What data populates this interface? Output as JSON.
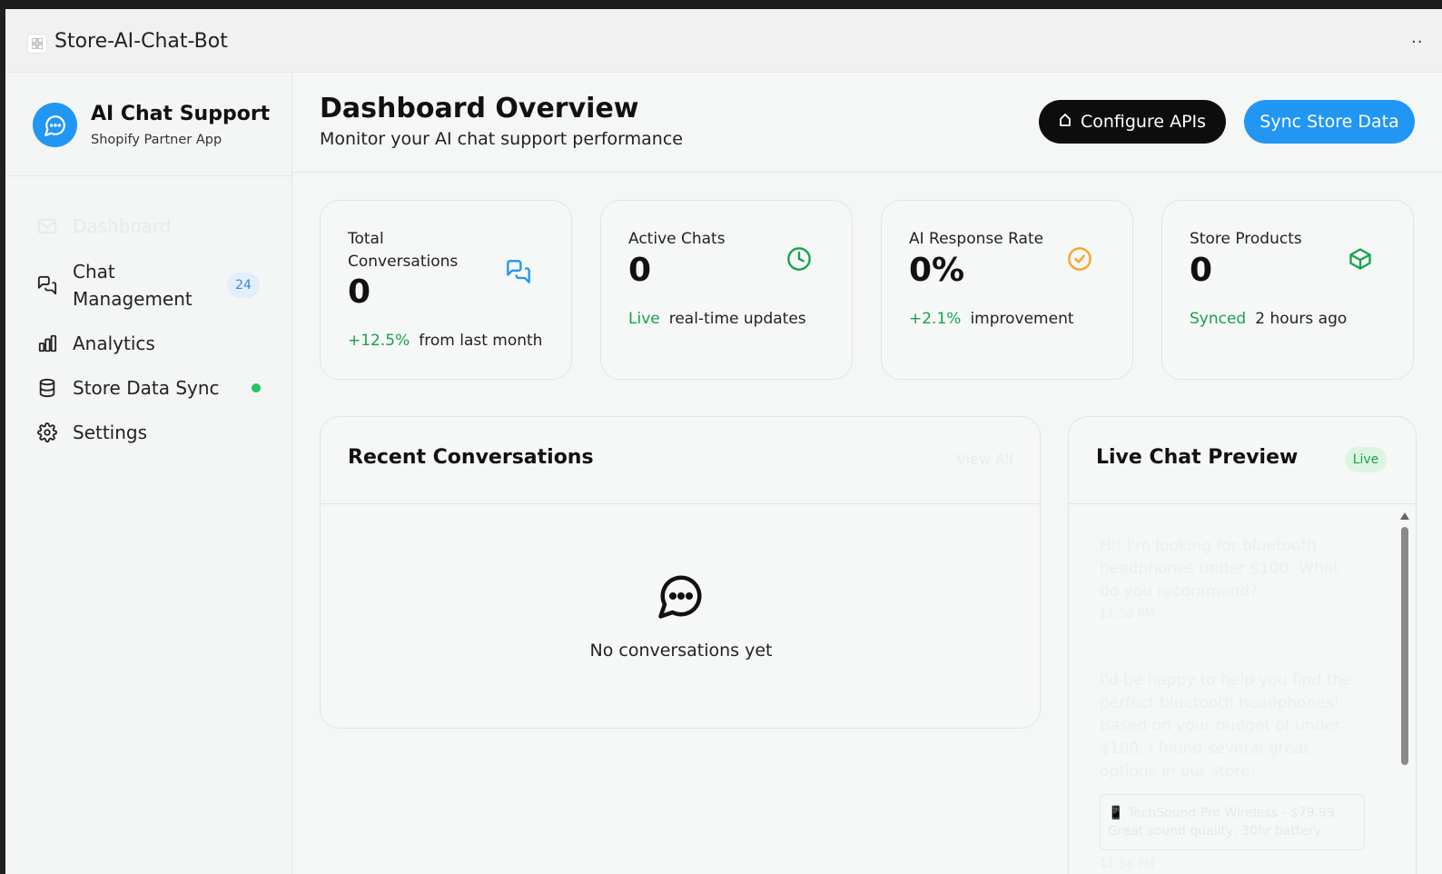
{
  "window": {
    "title": "Store-AI-Chat-Bot",
    "menu_glyph": "··"
  },
  "brand": {
    "name": "AI Chat Support",
    "subtitle": "Shopify Partner App",
    "colors": {
      "primary": "#2196f3"
    }
  },
  "nav": {
    "items": [
      {
        "label": "Dashboard",
        "icon": "dashboard-icon",
        "active": true
      },
      {
        "label": "Chat\nManagement",
        "icon": "chat-icon",
        "badge": "24"
      },
      {
        "label": "Analytics",
        "icon": "bar-chart-icon"
      },
      {
        "label": "Store Data Sync",
        "icon": "database-icon",
        "status": "online"
      },
      {
        "label": "Settings",
        "icon": "gear-icon"
      }
    ]
  },
  "header": {
    "title": "Dashboard Overview",
    "subtitle": "Monitor your AI chat support performance",
    "configure_label": "Configure APIs",
    "sync_label": "Sync Store Data"
  },
  "stats": [
    {
      "label": "Total Conversations",
      "value": "0",
      "accent": "+12.5%",
      "note": "from last month",
      "icon": "chat-bubbles-icon",
      "color": "#2196f3"
    },
    {
      "label": "Active Chats",
      "value": "0",
      "accent": "Live",
      "note": "real-time updates",
      "icon": "clock-icon",
      "color": "#16a34a"
    },
    {
      "label": "AI Response Rate",
      "value": "0%",
      "accent": "+2.1%",
      "note": "improvement",
      "icon": "check-circle-icon",
      "color": "#f5a623"
    },
    {
      "label": "Store Products",
      "value": "0",
      "accent": "Synced",
      "note": "2 hours ago",
      "icon": "box-icon",
      "color": "#16a34a"
    }
  ],
  "recent": {
    "title": "Recent Conversations",
    "view_all": "View All",
    "empty_text": "No conversations yet"
  },
  "live": {
    "title": "Live Chat Preview",
    "badge": "Live",
    "messages": [
      {
        "text": "Hi! I'm looking for bluetooth headphones under $100. What do you recommend?",
        "time": "11:58 PM"
      },
      {
        "text": "I'd be happy to help you find the perfect bluetooth headphones! Based on your budget of under $100, I found several great options in our store:"
      }
    ],
    "product": {
      "line1": "📱 TechSound Pro Wireless - $79.99",
      "line2": "Great sound quality, 30hr battery"
    },
    "last_time": "11:58 PM"
  }
}
